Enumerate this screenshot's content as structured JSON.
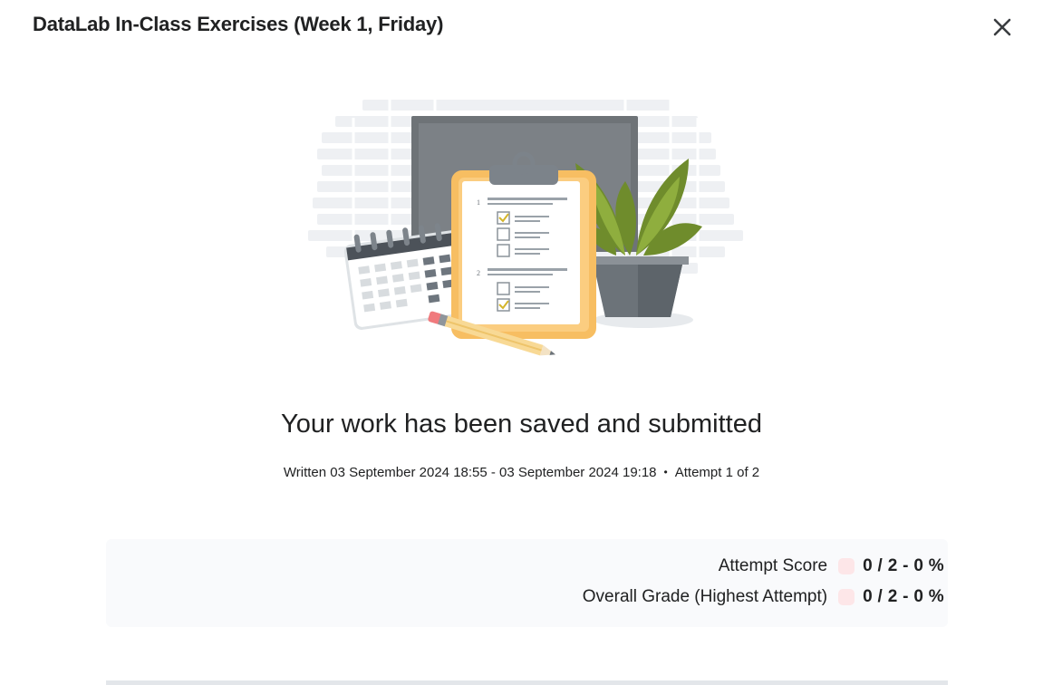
{
  "dialog": {
    "title": "DataLab In-Class Exercises (Week 1, Friday)",
    "close_icon": "close-icon"
  },
  "illustration": {
    "icon": "quiz-submitted-illustration",
    "question_numbers": [
      "1",
      "2"
    ]
  },
  "status": {
    "heading": "Your work has been saved and submitted",
    "written": "Written 03 September 2024 18:55 - 03 September 2024 19:18",
    "separator": "•",
    "attempt": "Attempt 1 of 2"
  },
  "scores": [
    {
      "label": "Attempt Score",
      "value": "0 / 2 - 0 %"
    },
    {
      "label": "Overall Grade (Highest Attempt)",
      "value": "0 / 2 - 0 %"
    }
  ],
  "colors": {
    "score_swatch": "#fde6e8",
    "score_panel": "#f9fafc"
  }
}
